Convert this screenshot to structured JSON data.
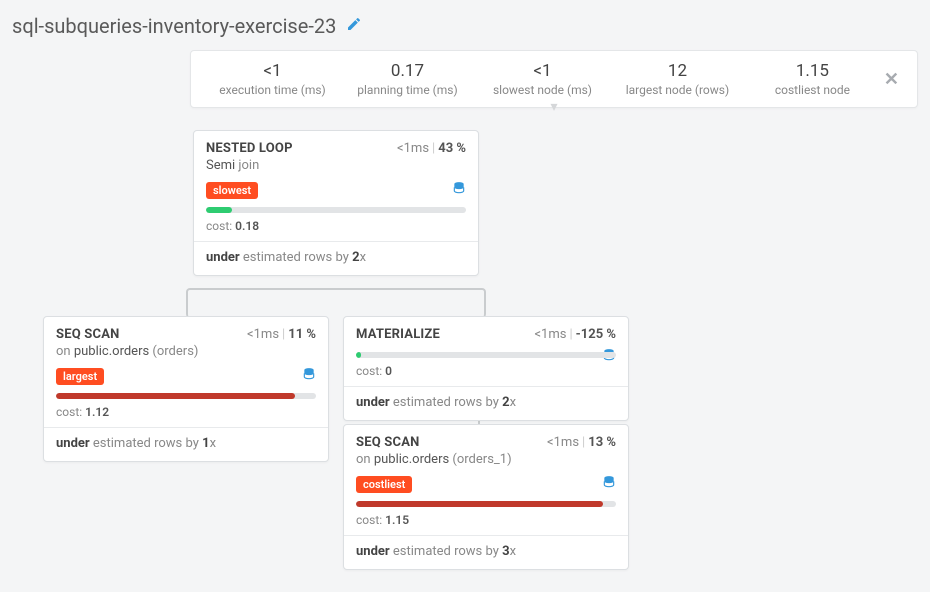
{
  "page": {
    "title": "sql-subqueries-inventory-exercise-23"
  },
  "stats": {
    "exec_value": "<1",
    "exec_label": "execution time (ms)",
    "plan_value": "0.17",
    "plan_label": "planning time (ms)",
    "slow_value": "<1",
    "slow_label": "slowest node (ms)",
    "large_value": "12",
    "large_label": "largest node (rows)",
    "cost_value": "1.15",
    "cost_label": "costliest node"
  },
  "nodes": {
    "nestedloop": {
      "title": "NESTED LOOP",
      "time": "<1ms",
      "pct": "43 %",
      "sub_prefix": "Semi ",
      "sub_light": "join",
      "badge": "slowest",
      "bar_pct": 10,
      "bar_color": "green",
      "cost_label": "cost: ",
      "cost_value": "0.18",
      "est_prefix": "under",
      "est_mid": " estimated rows by ",
      "est_factor": "2",
      "est_suffix": "x"
    },
    "seqscan1": {
      "title": "SEQ SCAN",
      "time": "<1ms",
      "pct": "11 %",
      "sub_light1": "on ",
      "sub_dark": "public.orders",
      "sub_light2": " (orders)",
      "badge": "largest",
      "bar_pct": 92,
      "bar_color": "red",
      "cost_label": "cost: ",
      "cost_value": "1.12",
      "est_prefix": "under",
      "est_mid": " estimated rows by ",
      "est_factor": "1",
      "est_suffix": "x"
    },
    "materialize": {
      "title": "MATERIALIZE",
      "time": "<1ms",
      "pct": "-125 %",
      "bar_pct": 2,
      "bar_color": "green",
      "cost_label": "cost: ",
      "cost_value": "0",
      "est_prefix": "under",
      "est_mid": " estimated rows by ",
      "est_factor": "2",
      "est_suffix": "x"
    },
    "seqscan2": {
      "title": "SEQ SCAN",
      "time": "<1ms",
      "pct": "13 %",
      "sub_light1": "on ",
      "sub_dark": "public.orders",
      "sub_light2": " (orders_1)",
      "badge": "costliest",
      "bar_pct": 95,
      "bar_color": "red",
      "cost_label": "cost: ",
      "cost_value": "1.15",
      "est_prefix": "under",
      "est_mid": " estimated rows by ",
      "est_factor": "3",
      "est_suffix": "x"
    }
  }
}
